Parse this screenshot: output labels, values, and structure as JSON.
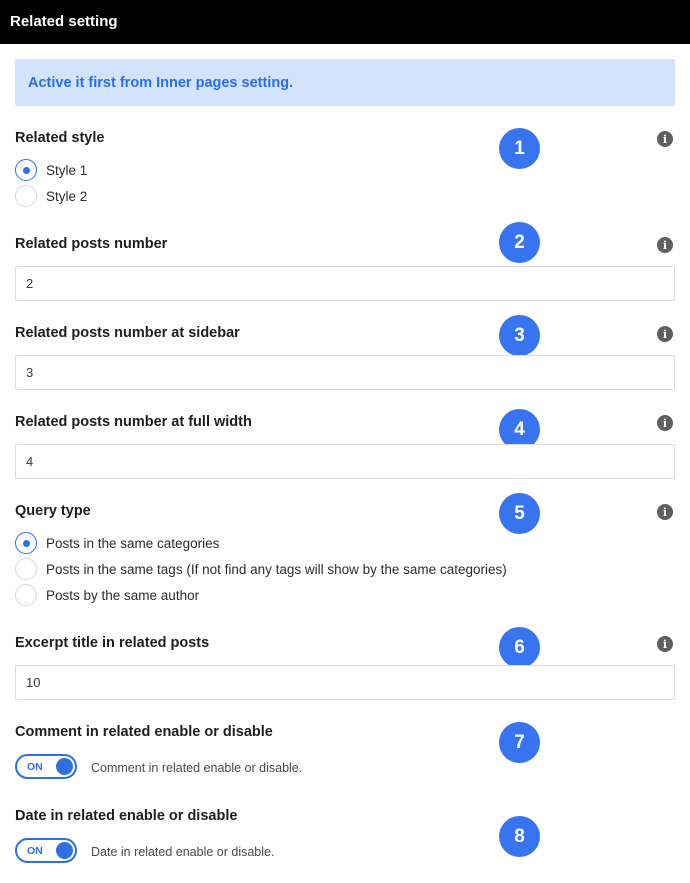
{
  "header": {
    "title": "Related setting"
  },
  "notice": {
    "text": "Active it first from Inner pages setting."
  },
  "info_icon": "info-icon",
  "accent_color": "#2f6fe4",
  "badge_color": "#3874f0",
  "sections": {
    "related_style": {
      "label": "Related style",
      "badge": "1",
      "options": [
        {
          "label": "Style 1",
          "checked": true
        },
        {
          "label": "Style 2",
          "checked": false
        }
      ]
    },
    "related_posts_number": {
      "label": "Related posts number",
      "badge": "2",
      "value": "2"
    },
    "related_posts_sidebar": {
      "label": "Related posts number at sidebar",
      "badge": "3",
      "value": "3"
    },
    "related_posts_full_width": {
      "label": "Related posts number at full width",
      "badge": "4",
      "value": "4"
    },
    "query_type": {
      "label": "Query type",
      "badge": "5",
      "options": [
        {
          "label": "Posts in the same categories",
          "checked": true
        },
        {
          "label": "Posts in the same tags (If not find any tags will show by the same categories)",
          "checked": false
        },
        {
          "label": "Posts by the same author",
          "checked": false
        }
      ]
    },
    "excerpt_title": {
      "label": "Excerpt title in related posts",
      "badge": "6",
      "value": "10"
    },
    "comment_toggle": {
      "label": "Comment in related enable or disable",
      "badge": "7",
      "state": "ON",
      "description": "Comment in related enable or disable."
    },
    "date_toggle": {
      "label": "Date in related enable or disable",
      "badge": "8",
      "state": "ON",
      "description": "Date in related enable or disable."
    }
  }
}
